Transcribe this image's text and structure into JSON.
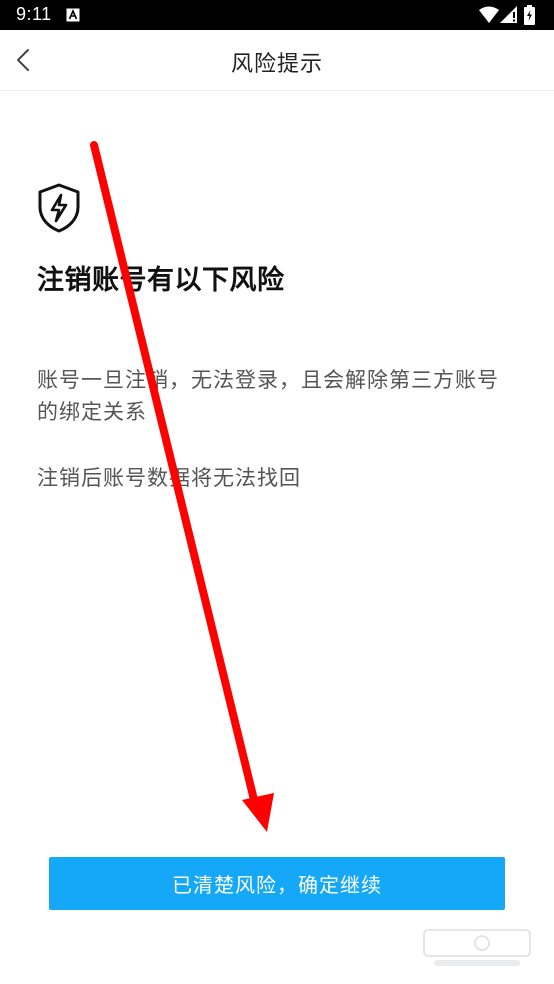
{
  "status_bar": {
    "time": "9:11",
    "icons": [
      "notification-a-icon",
      "wifi-icon",
      "signal-icon",
      "battery-icon"
    ]
  },
  "header": {
    "title": "风险提示",
    "back_icon": "chevron-left-icon"
  },
  "content": {
    "icon": "shield-lightning-icon",
    "heading": "注销账号有以下风险",
    "risks": [
      "账号一旦注销，无法登录，且会解除第三方账号的绑定关系",
      "注销后账号数据将无法找回"
    ]
  },
  "footer": {
    "confirm_label": "已清楚风险，确定继续"
  },
  "colors": {
    "primary_button": "#16a8f8",
    "annotation_arrow": "#ff0000",
    "status_bar": "#000000"
  }
}
